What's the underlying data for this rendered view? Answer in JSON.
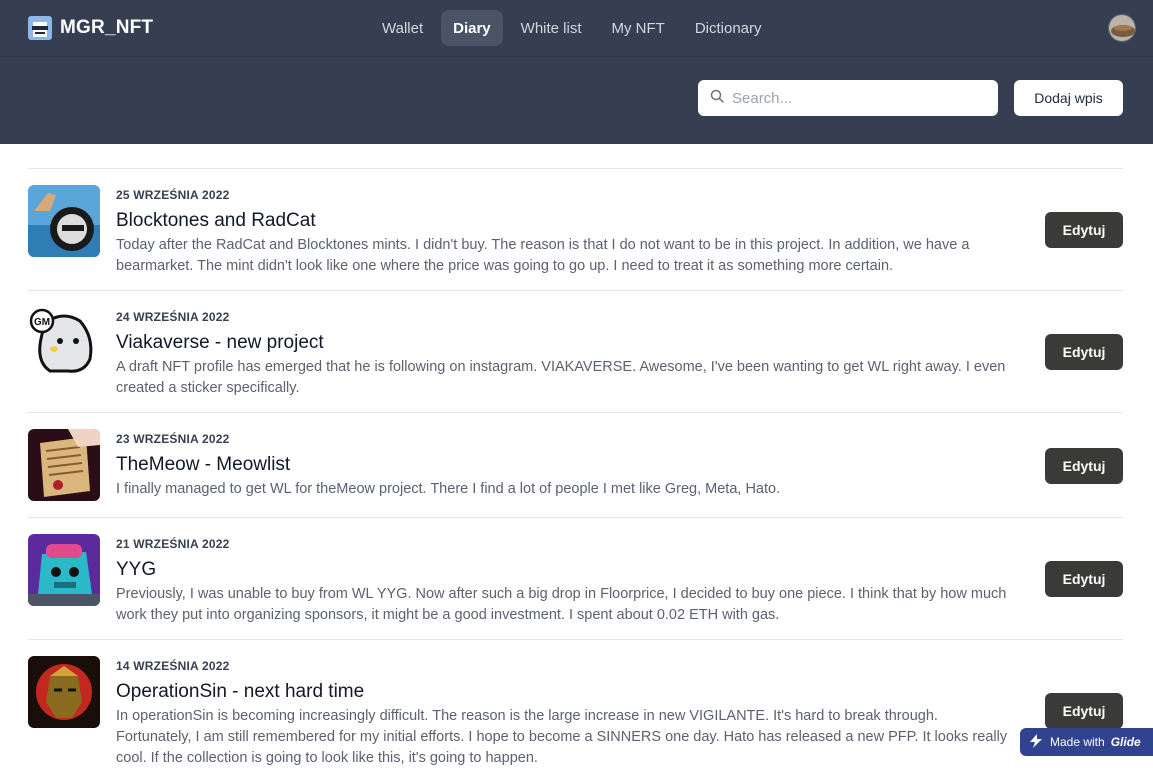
{
  "app": {
    "brand": "MGR_NFT"
  },
  "nav": {
    "items": [
      {
        "label": "Wallet",
        "active": false
      },
      {
        "label": "Diary",
        "active": true
      },
      {
        "label": "White list",
        "active": false
      },
      {
        "label": "My NFT",
        "active": false
      },
      {
        "label": "Dictionary",
        "active": false
      }
    ]
  },
  "toolbar": {
    "search_placeholder": "Search...",
    "add_label": "Dodaj wpis"
  },
  "entries": [
    {
      "date": "25 WRZEŚNIA 2022",
      "title": "Blocktones and RadCat",
      "body": "Today after the RadCat and Blocktones mints. I didn't buy. The reason is that I do not want to be in this project. In addition, we have a bearmarket. The mint didn't look like one where the price was going to go up. I need to treat it as something more certain.",
      "edit_label": "Edytuj"
    },
    {
      "date": "24 WRZEŚNIA 2022",
      "title": "Viakaverse - new project",
      "body": "A draft NFT profile has emerged that he is following on instagram. VIAKAVERSE. Awesome, I've been wanting to get WL right away. I even created a sticker specifically.",
      "edit_label": "Edytuj"
    },
    {
      "date": "23 WRZEŚNIA 2022",
      "title": "TheMeow - Meowlist",
      "body": "I finally managed to get WL for theMeow project. There I find a lot of people I met like Greg, Meta, Hato.",
      "edit_label": "Edytuj"
    },
    {
      "date": "21 WRZEŚNIA 2022",
      "title": "YYG",
      "body": "Previously, I was unable to buy from WL YYG. Now after such a big drop in Floorprice, I decided to buy one piece. I think that by how much work they put into organizing sponsors, it might be a good investment. I spent about 0.02 ETH with gas.",
      "edit_label": "Edytuj"
    },
    {
      "date": "14 WRZEŚNIA 2022",
      "title": "OperationSin - next hard time",
      "body": "In operationSin is becoming increasingly difficult. The reason is the large increase in new VIGILANTE. It's hard to break through. Fortunately, I am still remembered for my initial efforts. I hope to become a SINNERS one day. Hato has released a new PFP. It looks really cool. If the collection is going to look like this, it's going to happen.",
      "edit_label": "Edytuj"
    }
  ],
  "badge": {
    "prefix": "Made with",
    "brand": "Glide"
  }
}
